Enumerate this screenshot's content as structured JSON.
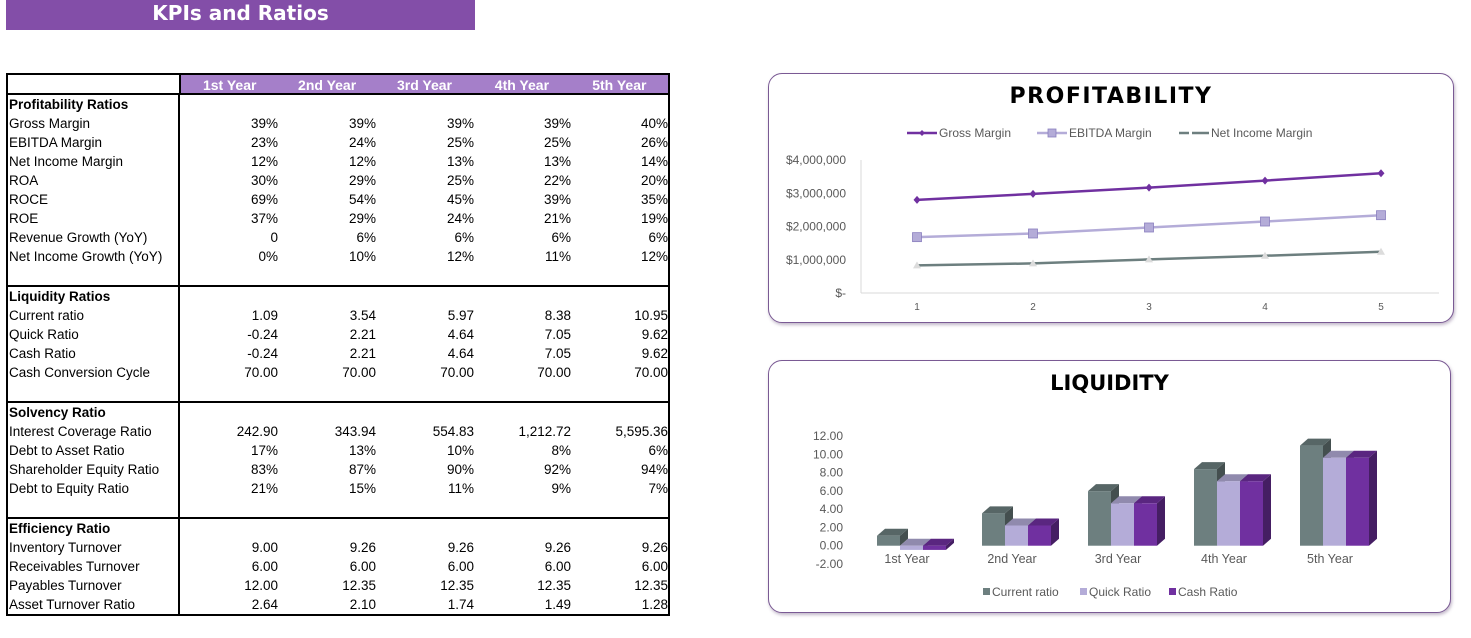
{
  "title": "KPIs and Ratios",
  "years": [
    "1st Year",
    "2nd Year",
    "3rd Year",
    "4th Year",
    "5th Year"
  ],
  "sections": [
    {
      "title": "Profitability Ratios",
      "rows": [
        {
          "label": "Gross Margin",
          "values": [
            "39%",
            "39%",
            "39%",
            "39%",
            "40%"
          ]
        },
        {
          "label": "EBITDA Margin",
          "values": [
            "23%",
            "24%",
            "25%",
            "25%",
            "26%"
          ]
        },
        {
          "label": "Net Income Margin",
          "values": [
            "12%",
            "12%",
            "13%",
            "13%",
            "14%"
          ]
        },
        {
          "label": "ROA",
          "values": [
            "30%",
            "29%",
            "25%",
            "22%",
            "20%"
          ]
        },
        {
          "label": "ROCE",
          "values": [
            "69%",
            "54%",
            "45%",
            "39%",
            "35%"
          ]
        },
        {
          "label": "ROE",
          "values": [
            "37%",
            "29%",
            "24%",
            "21%",
            "19%"
          ]
        },
        {
          "label": "Revenue Growth (YoY)",
          "values": [
            "0",
            "6%",
            "6%",
            "6%",
            "6%"
          ]
        },
        {
          "label": "Net Income Growth (YoY)",
          "values": [
            "0%",
            "10%",
            "12%",
            "11%",
            "12%"
          ]
        }
      ],
      "trailing_blank": true
    },
    {
      "title": "Liquidity Ratios",
      "rows": [
        {
          "label": "Current ratio",
          "values": [
            "1.09",
            "3.54",
            "5.97",
            "8.38",
            "10.95"
          ]
        },
        {
          "label": "Quick Ratio",
          "values": [
            "-0.24",
            "2.21",
            "4.64",
            "7.05",
            "9.62"
          ]
        },
        {
          "label": "Cash Ratio",
          "values": [
            "-0.24",
            "2.21",
            "4.64",
            "7.05",
            "9.62"
          ]
        },
        {
          "label": "Cash Conversion Cycle",
          "values": [
            "70.00",
            "70.00",
            "70.00",
            "70.00",
            "70.00"
          ]
        }
      ],
      "trailing_blank": true
    },
    {
      "title": "Solvency Ratio",
      "rows": [
        {
          "label": "Interest Coverage Ratio",
          "values": [
            "242.90",
            "343.94",
            "554.83",
            "1,212.72",
            "5,595.36"
          ]
        },
        {
          "label": "Debt to Asset Ratio",
          "values": [
            "17%",
            "13%",
            "10%",
            "8%",
            "6%"
          ]
        },
        {
          "label": "Shareholder Equity Ratio",
          "values": [
            "83%",
            "87%",
            "90%",
            "92%",
            "94%"
          ]
        },
        {
          "label": "Debt to Equity Ratio",
          "values": [
            "21%",
            "15%",
            "11%",
            "9%",
            "7%"
          ]
        }
      ],
      "trailing_blank": true
    },
    {
      "title": "Efficiency Ratio",
      "rows": [
        {
          "label": "Inventory Turnover",
          "values": [
            "9.00",
            "9.26",
            "9.26",
            "9.26",
            "9.26"
          ]
        },
        {
          "label": "Receivables Turnover",
          "values": [
            "6.00",
            "6.00",
            "6.00",
            "6.00",
            "6.00"
          ]
        },
        {
          "label": "Payables Turnover",
          "values": [
            "12.00",
            "12.35",
            "12.35",
            "12.35",
            "12.35"
          ]
        },
        {
          "label": "Asset Turnover Ratio",
          "values": [
            "2.64",
            "2.10",
            "1.74",
            "1.49",
            "1.28"
          ]
        }
      ],
      "trailing_blank": false
    }
  ],
  "chart_data": [
    {
      "type": "line",
      "title": "PROFITABILITY",
      "x": [
        1,
        2,
        3,
        4,
        5
      ],
      "series": [
        {
          "name": "Gross Margin",
          "values": [
            2800000,
            2980000,
            3170000,
            3380000,
            3600000
          ],
          "color": "#7030a0",
          "marker": "diamond"
        },
        {
          "name": "EBITDA Margin",
          "values": [
            1680000,
            1790000,
            1970000,
            2150000,
            2340000
          ],
          "color": "#b4acd8",
          "marker": "square"
        },
        {
          "name": "Net Income Margin",
          "values": [
            830000,
            890000,
            1010000,
            1120000,
            1240000
          ],
          "color": "#6d7f7f",
          "marker": "triangle"
        }
      ],
      "yticks": [
        "$-",
        "$1,000,000",
        "$2,000,000",
        "$3,000,000",
        "$4,000,000"
      ],
      "ylim": [
        0,
        4000000
      ],
      "xlabel": "",
      "ylabel": "",
      "legend": "top",
      "grid": false
    },
    {
      "type": "bar",
      "title": "LIQUIDITY",
      "categories": [
        "1st Year",
        "2nd Year",
        "3rd Year",
        "4th Year",
        "5th Year"
      ],
      "series": [
        {
          "name": "Current ratio",
          "values": [
            1.09,
            3.54,
            5.97,
            8.38,
            10.95
          ],
          "color": "#6d7f7f"
        },
        {
          "name": "Quick Ratio",
          "values": [
            -0.24,
            2.21,
            4.64,
            7.05,
            9.62
          ],
          "color": "#b4acd8"
        },
        {
          "name": "Cash Ratio",
          "values": [
            -0.24,
            2.21,
            4.64,
            7.05,
            9.62
          ],
          "color": "#7030a0"
        }
      ],
      "yticks": [
        "-2.00",
        "0.00",
        "2.00",
        "4.00",
        "6.00",
        "8.00",
        "10.00",
        "12.00"
      ],
      "ylim": [
        -2,
        12
      ],
      "xlabel": "",
      "ylabel": "",
      "legend": "bottom",
      "grid": false,
      "style": "3d-column"
    }
  ]
}
